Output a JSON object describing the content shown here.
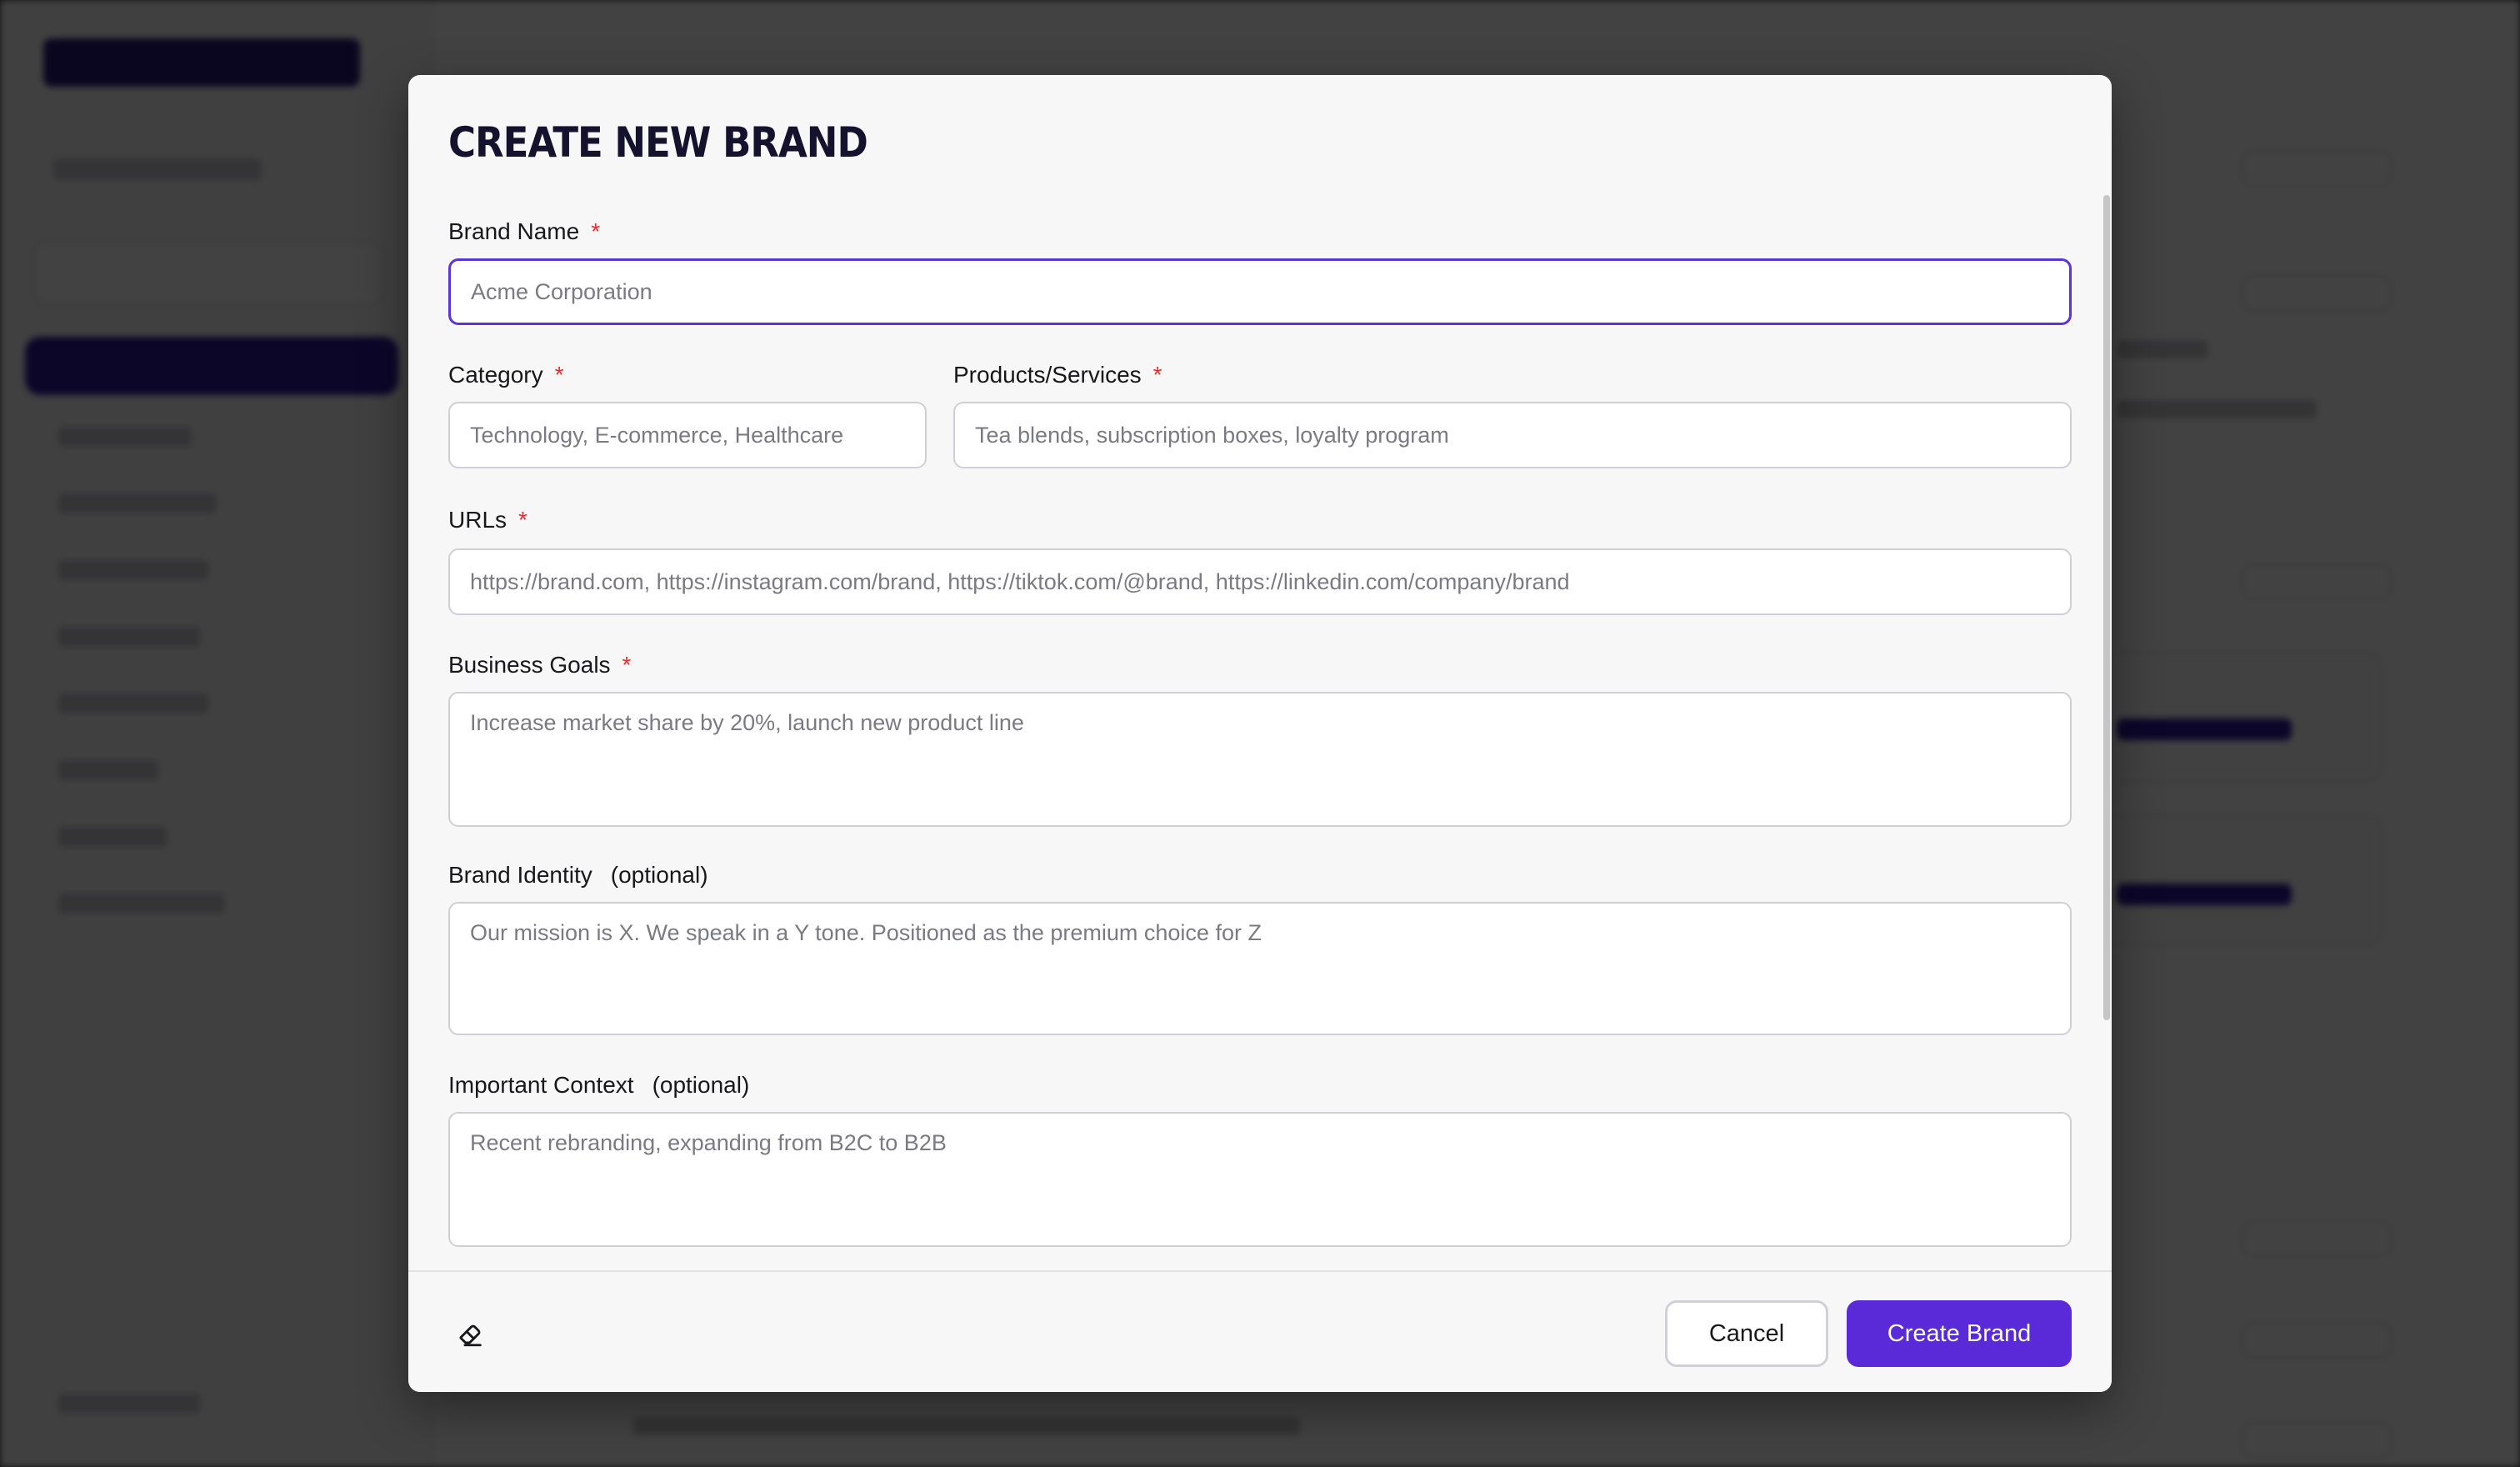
{
  "modal": {
    "title": "CREATE NEW BRAND"
  },
  "fields": {
    "brand_name": {
      "label": "Brand Name",
      "required_mark": "*",
      "placeholder": "Acme Corporation",
      "value": ""
    },
    "category": {
      "label": "Category",
      "required_mark": "*",
      "placeholder": "Technology, E-commerce, Healthcare",
      "value": ""
    },
    "products": {
      "label": "Products/Services",
      "required_mark": "*",
      "placeholder": "Tea blends, subscription boxes, loyalty program",
      "value": ""
    },
    "urls": {
      "label": "URLs",
      "required_mark": "*",
      "placeholder": "https://brand.com, https://instagram.com/brand, https://tiktok.com/@brand, https://linkedin.com/company/brand",
      "value": ""
    },
    "business_goals": {
      "label": "Business Goals",
      "required_mark": "*",
      "placeholder": "Increase market share by 20%, launch new product line",
      "value": ""
    },
    "brand_identity": {
      "label": "Brand Identity",
      "optional_mark": "(optional)",
      "placeholder": "Our mission is X. We speak in a Y tone. Positioned as the premium choice for Z",
      "value": ""
    },
    "important_context": {
      "label": "Important Context",
      "optional_mark": "(optional)",
      "placeholder": "Recent rebranding, expanding from B2C to B2B",
      "value": ""
    }
  },
  "footer": {
    "clear_icon": "eraser-icon",
    "cancel_label": "Cancel",
    "create_label": "Create Brand"
  },
  "colors": {
    "accent": "#5a2ad8",
    "focus_border": "#5b35d5",
    "required": "#e0302f"
  }
}
